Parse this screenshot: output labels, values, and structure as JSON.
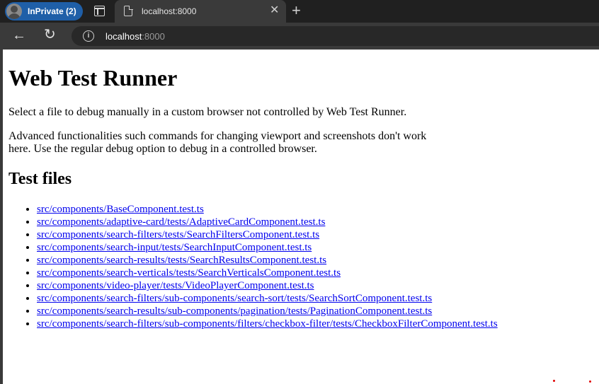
{
  "browser": {
    "profile_label": "InPrivate (2)",
    "tab": {
      "title": "localhost:8000",
      "close_glyph": "✕"
    },
    "new_tab_glyph": "+",
    "back_glyph": "←",
    "reload_glyph": "↻",
    "info_glyph": "i",
    "address": {
      "host": "localhost",
      "port": ":8000"
    },
    "accent_color": "#1f5fa8"
  },
  "page": {
    "title": "Web Test Runner",
    "intro": "Select a file to debug manually in a custom browser not controlled by Web Test Runner.",
    "note": "Advanced functionalities such commands for changing viewport and screenshots don't work here. Use the regular debug option to debug in a controlled browser.",
    "section_title": "Test files",
    "files": [
      "src/components/BaseComponent.test.ts",
      "src/components/adaptive-card/tests/AdaptiveCardComponent.test.ts",
      "src/components/search-filters/tests/SearchFiltersComponent.test.ts",
      "src/components/search-input/tests/SearchInputComponent.test.ts",
      "src/components/search-results/tests/SearchResultsComponent.test.ts",
      "src/components/search-verticals/tests/SearchVerticalsComponent.test.ts",
      "src/components/video-player/tests/VideoPlayerComponent.test.ts",
      "src/components/search-filters/sub-components/search-sort/tests/SearchSortComponent.test.ts",
      "src/components/search-results/sub-components/pagination/tests/PaginationComponent.test.ts",
      "src/components/search-filters/sub-components/filters/checkbox-filter/tests/CheckboxFilterComponent.test.ts"
    ]
  }
}
